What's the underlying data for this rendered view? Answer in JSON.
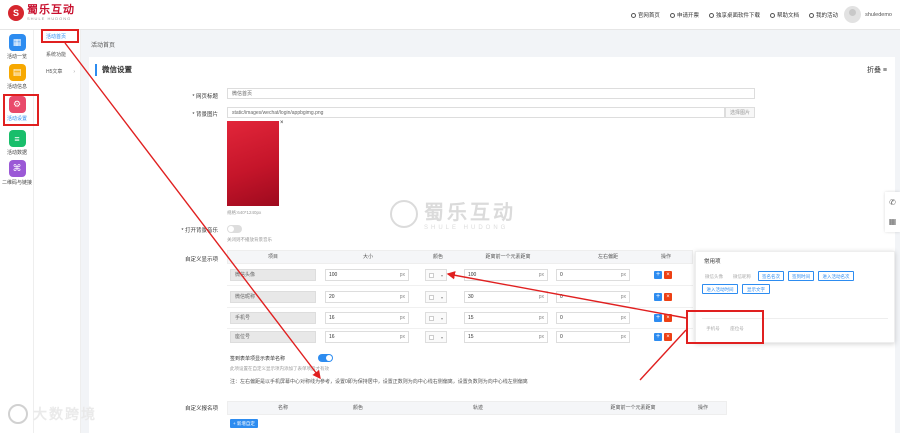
{
  "logo": {
    "mark": "S",
    "name": "蜀乐互动",
    "tagline": "SHULE HUDONG"
  },
  "top_links": [
    "官网首页",
    "申请开票",
    "独享桌面软件下载",
    "帮助文档",
    "我的活动"
  ],
  "user": {
    "name": "shuledemo"
  },
  "nav": [
    {
      "label": "活动一览",
      "icon": "grid-icon",
      "color": "#2d8cf0",
      "glyph": "▦"
    },
    {
      "label": "活动信息",
      "icon": "document-icon",
      "color": "#f7a800",
      "glyph": "▤"
    },
    {
      "label": "活动设置",
      "icon": "gear-icon",
      "color": "#e94a6b",
      "glyph": "⚙"
    },
    {
      "label": "活动数据",
      "icon": "database-icon",
      "color": "#19be6b",
      "glyph": "≡"
    },
    {
      "label": "二维码与链接",
      "icon": "qrcode-icon",
      "color": "#9b59d6",
      "glyph": "⌘"
    }
  ],
  "subnav": [
    "活动首页",
    "系统功能",
    "H5文章"
  ],
  "breadcrumb": "活动首页",
  "section": {
    "title": "微信设置",
    "fold": "折叠 ≡"
  },
  "form": {
    "page_title_label": "* 网页标题",
    "page_title_value": "微信首页",
    "bg_label": "* 背景图片",
    "bg_value": "static/images/wechat/login/appbgimg.png",
    "select_image": "选择图片",
    "bg_size_hint": "规格:640*1240px",
    "open_bg_music_label": "* 打开背景音乐",
    "music_hint": "关闭则不播放背景音乐",
    "custom_display_label": "自定义显示项",
    "custom_signup_label": "自定义报名项"
  },
  "table": {
    "headers": [
      "项目",
      "大小",
      "颜色",
      "距离前一个元素距离",
      "左右偏距",
      "操作"
    ],
    "rows": [
      {
        "item": "微信头像",
        "size": "100",
        "distance": "100",
        "offset": "0"
      },
      {
        "item": "微信昵称",
        "size": "20",
        "distance": "30",
        "offset": "0"
      },
      {
        "item": "手机号",
        "size": "16",
        "distance": "15",
        "offset": "0"
      },
      {
        "item": "座位号",
        "size": "16",
        "distance": "15",
        "offset": "0"
      }
    ],
    "unit": "px"
  },
  "signin_toggle_label": "签到表单项显示表单名称",
  "signin_hint": "此项设置在自定义显示项内添加了表单项后才有效",
  "note": "注：左右偏距是以手机屏幕中心对称线为参考，设置0即为保持居中，设置正数则为向中心线右侧偏离，设置负数则为向中心线左侧偏离",
  "popup": {
    "title": "常用项",
    "chips": [
      {
        "label": "微信头像",
        "active": false
      },
      {
        "label": "微信昵称",
        "active": false
      },
      {
        "label": "签名名次",
        "active": true
      },
      {
        "label": "签到时间",
        "active": true
      },
      {
        "label": "进入活动名次",
        "active": true
      },
      {
        "label": "进入活动时间",
        "active": true
      },
      {
        "label": "显示文字",
        "active": true
      }
    ],
    "sub_chips": [
      "手机号",
      "座位号"
    ]
  },
  "signup_table": {
    "headers": [
      "名称",
      "颜色",
      "轨迹",
      "距离前一个元素距离",
      "操作"
    ],
    "add_button": "+ 新增自定"
  },
  "watermark": {
    "cn": "蜀乐互动",
    "en": "SHULE HUDONG"
  },
  "brand": {
    "text": "大数跨境"
  },
  "accent_color": "#2d8cf0",
  "danger_color": "#ed4014",
  "annotation_color": "#e02020"
}
